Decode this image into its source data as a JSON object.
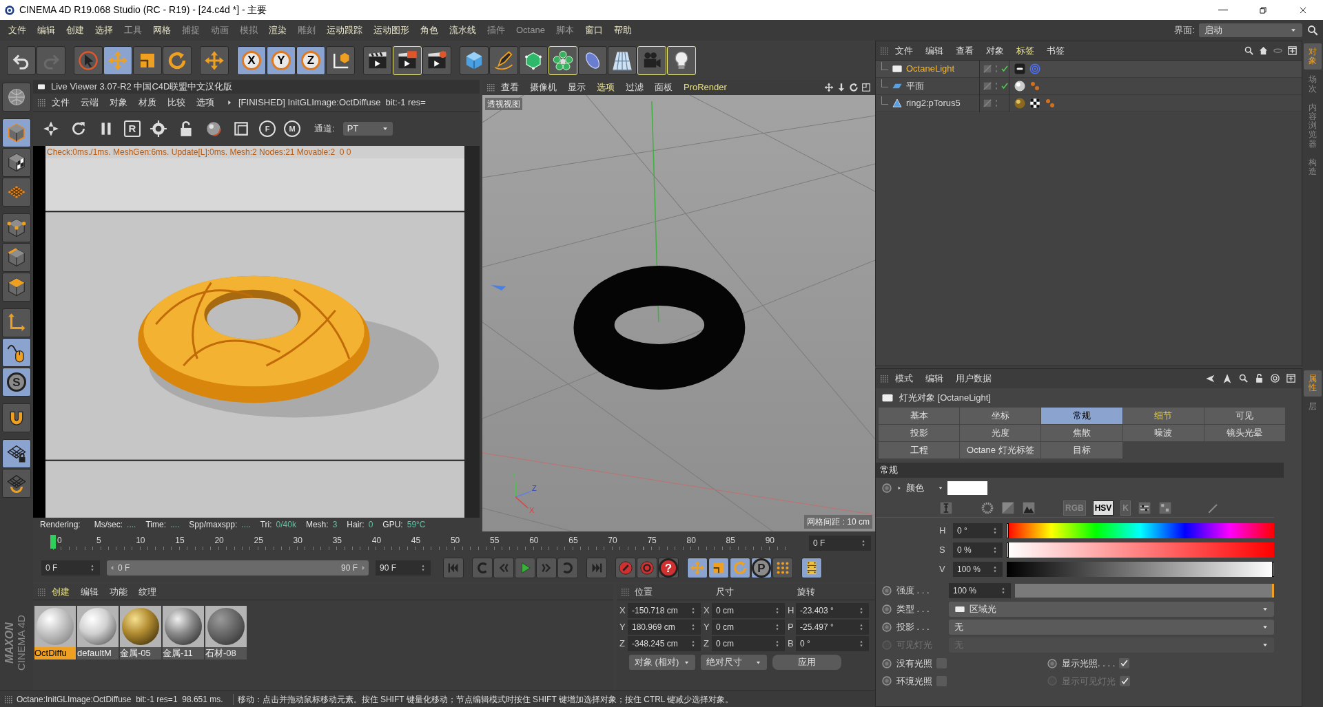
{
  "window": {
    "title": "CINEMA 4D R19.068 Studio (RC - R19) - [24.c4d *] - 主要"
  },
  "menu": [
    {
      "label": "文件",
      "dim": false
    },
    {
      "label": "编辑",
      "dim": false
    },
    {
      "label": "创建",
      "dim": false
    },
    {
      "label": "选择",
      "dim": false
    },
    {
      "label": "工具",
      "dim": true
    },
    {
      "label": "网格",
      "dim": false
    },
    {
      "label": "捕捉",
      "dim": true
    },
    {
      "label": "动画",
      "dim": true
    },
    {
      "label": "模拟",
      "dim": true
    },
    {
      "label": "渲染",
      "dim": false
    },
    {
      "label": "雕刻",
      "dim": true
    },
    {
      "label": "运动跟踪",
      "dim": false
    },
    {
      "label": "运动图形",
      "dim": false
    },
    {
      "label": "角色",
      "dim": false
    },
    {
      "label": "流水线",
      "dim": false
    },
    {
      "label": "插件",
      "dim": true
    },
    {
      "label": "Octane",
      "dim": true
    },
    {
      "label": "脚本",
      "dim": true
    },
    {
      "label": "窗口",
      "dim": false
    },
    {
      "label": "帮助",
      "dim": false
    }
  ],
  "layout": {
    "label": "界面:",
    "value": "启动"
  },
  "toolbar": [
    [
      {
        "kind": "undo",
        "selected": false,
        "highlighted": false
      },
      {
        "kind": "redo",
        "selected": false,
        "highlighted": false
      }
    ],
    [
      {
        "kind": "pointer",
        "selected": false,
        "highlighted": false
      },
      {
        "kind": "move",
        "selected": true,
        "highlighted": false
      },
      {
        "kind": "scale",
        "selected": false,
        "highlighted": false
      },
      {
        "kind": "rotate",
        "selected": false,
        "highlighted": false
      }
    ],
    [
      {
        "kind": "plus",
        "selected": false,
        "highlighted": false
      }
    ],
    [
      {
        "kind": "letter",
        "label": "X",
        "selected": true,
        "highlighted": false
      },
      {
        "kind": "letter",
        "label": "Y",
        "selected": true,
        "highlighted": false
      },
      {
        "kind": "letter",
        "label": "Z",
        "selected": true,
        "highlighted": false
      },
      {
        "kind": "coord",
        "selected": false,
        "highlighted": false
      }
    ],
    [
      {
        "kind": "clap",
        "selected": false,
        "highlighted": false
      },
      {
        "kind": "clap2",
        "selected": false,
        "highlighted": true
      },
      {
        "kind": "clap3",
        "selected": false,
        "highlighted": false
      }
    ],
    [
      {
        "kind": "cube",
        "selected": false,
        "highlighted": false
      },
      {
        "kind": "pen",
        "selected": false,
        "highlighted": false
      },
      {
        "kind": "greencube",
        "selected": false,
        "highlighted": false
      },
      {
        "kind": "flower",
        "selected": false,
        "highlighted": true
      },
      {
        "kind": "deformer",
        "selected": false,
        "highlighted": false
      },
      {
        "kind": "floor",
        "selected": false,
        "highlighted": false
      },
      {
        "kind": "camera",
        "selected": false,
        "highlighted": true
      },
      {
        "kind": "bulb",
        "selected": false,
        "highlighted": true
      }
    ]
  ],
  "left_tools": [
    [
      {
        "kind": "globe",
        "selected": false
      }
    ],
    [
      {
        "kind": "model",
        "selected": true
      },
      {
        "kind": "texture",
        "selected": false
      },
      {
        "kind": "workplane",
        "selected": false
      }
    ],
    [
      {
        "kind": "points",
        "selected": false
      },
      {
        "kind": "edges",
        "selected": false
      },
      {
        "kind": "polys",
        "selected": false
      }
    ],
    [
      {
        "kind": "axis",
        "selected": false
      },
      {
        "kind": "tweak",
        "selected": true
      },
      {
        "kind": "letter",
        "label": "S",
        "selected": true
      }
    ],
    [
      {
        "kind": "magnet",
        "selected": false
      }
    ],
    [
      {
        "kind": "gridlock",
        "selected": true
      },
      {
        "kind": "gridrot",
        "selected": false
      }
    ]
  ],
  "logo": {
    "brand": "MAXON",
    "product": "CINEMA 4D"
  },
  "live_viewer": {
    "title": "Live Viewer 3.07-R2 中国C4D联盟中文汉化版",
    "menu": [
      "文件",
      "云端",
      "对象",
      "材质",
      "比较",
      "选项"
    ],
    "message": "[FINISHED] InitGLImage:OctDiffuse  bit:-1 res=",
    "toolbar": [
      {
        "kind": "aperture"
      },
      {
        "kind": "refresh"
      },
      {
        "kind": "pause"
      },
      {
        "kind": "letter",
        "label": "R"
      },
      {
        "kind": "gear"
      },
      {
        "kind": "lock"
      },
      {
        "kind": "sphere"
      },
      {
        "kind": "frame"
      },
      {
        "kind": "pin",
        "label": "F"
      },
      {
        "kind": "pin",
        "label": "M"
      }
    ],
    "channel_label": "通道:",
    "channel": "PT",
    "log": "Check:0ms./1ms. MeshGen:6ms. Update[L]:0ms. Mesh:2 Nodes:21 Movable:2  0 0",
    "stats": [
      {
        "label": "Rendering:"
      },
      {
        "label": "Ms/sec:",
        "value": "...."
      },
      {
        "label": "Time:",
        "value": "...."
      },
      {
        "label": "Spp/maxspp:",
        "value": "...."
      },
      {
        "label": "Tri:",
        "value": "0/40k"
      },
      {
        "label": "Mesh:",
        "value": "3"
      },
      {
        "label": "Hair:",
        "value": "0"
      },
      {
        "label": "GPU:",
        "value": "59°C"
      }
    ]
  },
  "viewport": {
    "menu": [
      {
        "label": "查看",
        "active": false
      },
      {
        "label": "摄像机",
        "active": false
      },
      {
        "label": "显示",
        "active": false
      },
      {
        "label": "选项",
        "active": true
      },
      {
        "label": "过滤",
        "active": false
      },
      {
        "label": "面板",
        "active": false
      },
      {
        "label": "ProRender",
        "active": true
      }
    ],
    "view_name": "透视视图",
    "axis_labels": [
      {
        "label": "Y",
        "color": "#50c050"
      },
      {
        "label": "Z",
        "color": "#2a48c8"
      },
      {
        "label": "X",
        "color": "#e04040"
      }
    ],
    "grid_spacing": "网格间距 : 10 cm"
  },
  "timeline": {
    "ticks": [
      "0",
      "5",
      "10",
      "15",
      "20",
      "25",
      "30",
      "35",
      "40",
      "45",
      "50",
      "55",
      "60",
      "65",
      "70",
      "75",
      "80",
      "85",
      "90"
    ],
    "level": 0,
    "frame": "0 F"
  },
  "transport": {
    "start": "0 F",
    "range_start": "0 F",
    "range_end": "90 F",
    "level": 1,
    "end": "90 F",
    "groups": [
      [
        {
          "kind": "skipstart",
          "selected": false
        }
      ],
      [
        {
          "kind": "loopback",
          "selected": false
        },
        {
          "kind": "stepback",
          "selected": false
        },
        {
          "kind": "play",
          "selected": false
        },
        {
          "kind": "stepfwd",
          "selected": false
        },
        {
          "kind": "loop",
          "selected": false
        }
      ],
      [
        {
          "kind": "skipend",
          "selected": false
        }
      ],
      [
        {
          "kind": "record",
          "selected": false
        },
        {
          "kind": "autokey",
          "selected": false
        },
        {
          "kind": "help",
          "label": "?",
          "selected": false
        }
      ],
      [
        {
          "kind": "move",
          "selected": true
        },
        {
          "kind": "scale",
          "selected": true
        },
        {
          "kind": "rotate",
          "selected": true
        },
        {
          "kind": "letter",
          "label": "P",
          "selected": true
        },
        {
          "kind": "dots",
          "selected": false
        }
      ],
      [
        {
          "kind": "film",
          "selected": true
        }
      ]
    ]
  },
  "materials": {
    "menu": [
      {
        "label": "创建",
        "active": true
      },
      {
        "label": "编辑",
        "active": false
      },
      {
        "label": "功能",
        "active": false
      },
      {
        "label": "纹理",
        "active": false
      }
    ],
    "items": [
      {
        "name": "OctDiffu",
        "kind": "matte",
        "selected": true
      },
      {
        "name": "defaultM",
        "kind": "glossy",
        "selected": false
      },
      {
        "name": "金属-05",
        "kind": "gold",
        "selected": false
      },
      {
        "name": "金属-11",
        "kind": "chrome",
        "selected": false
      },
      {
        "name": "石材-08",
        "kind": "stone",
        "selected": false
      }
    ]
  },
  "coordinates": {
    "headers": [
      "位置",
      "尺寸",
      "旋转"
    ],
    "rows": [
      [
        {
          "axis": "X",
          "value": "-150.718 cm"
        },
        {
          "axis": "X",
          "value": "0 cm"
        },
        {
          "axis": "H",
          "value": "-23.403 °"
        }
      ],
      [
        {
          "axis": "Y",
          "value": "180.969 cm"
        },
        {
          "axis": "Y",
          "value": "0 cm"
        },
        {
          "axis": "P",
          "value": "-25.497 °"
        }
      ],
      [
        {
          "axis": "Z",
          "value": "-348.245 cm"
        },
        {
          "axis": "Z",
          "value": "0 cm"
        },
        {
          "axis": "B",
          "value": "0 °"
        }
      ]
    ],
    "mode": "对象 (相对)",
    "size_mode": "绝对尺寸",
    "apply": "应用"
  },
  "status_bar": {
    "left": "Octane:InitGLImage:OctDiffuse  bit:-1 res=1  98.651 ms.",
    "right": "移动：点击并拖动鼠标移动元素。按住 SHIFT 键量化移动；节点编辑模式时按住 SHIFT 键增加选择对象；按住 CTRL 键减少选择对象。"
  },
  "object_manager": {
    "menu": [
      {
        "label": "文件",
        "active": false
      },
      {
        "label": "编辑",
        "active": false
      },
      {
        "label": "查看",
        "active": false
      },
      {
        "label": "对象",
        "active": false
      },
      {
        "label": "标签",
        "active": true
      },
      {
        "label": "书签",
        "active": false
      }
    ],
    "objects": [
      {
        "name": "OctaneLight",
        "kind": "light",
        "selected": true,
        "enabled": true
      },
      {
        "name": "平面",
        "kind": "plane",
        "selected": false,
        "enabled": true
      },
      {
        "name": "ring2:pTorus5",
        "kind": "mesh",
        "selected": false,
        "enabled": false
      }
    ]
  },
  "side_tabs_top": [
    {
      "label": "对象",
      "selected": true
    },
    {
      "label": "场次",
      "selected": false
    },
    {
      "label": "内容浏览器",
      "selected": false
    },
    {
      "label": "构造",
      "selected": false
    }
  ],
  "side_tabs_bottom": [
    {
      "label": "属性",
      "selected": true
    },
    {
      "label": "层",
      "selected": false
    }
  ],
  "attributes": {
    "menu": [
      "模式",
      "编辑",
      "用户数据"
    ],
    "title": "灯光对象 [OctaneLight]",
    "tabs": [
      {
        "label": "基本",
        "selected": false,
        "accent": false
      },
      {
        "label": "坐标",
        "selected": false,
        "accent": false
      },
      {
        "label": "常规",
        "selected": true,
        "accent": false
      },
      {
        "label": "细节",
        "selected": false,
        "accent": true
      },
      {
        "label": "可见",
        "selected": false,
        "accent": false
      },
      {
        "label": "投影",
        "selected": false,
        "accent": false
      },
      {
        "label": "光度",
        "selected": false,
        "accent": false
      },
      {
        "label": "焦散",
        "selected": false,
        "accent": false
      },
      {
        "label": "噪波",
        "selected": false,
        "accent": false
      },
      {
        "label": "镜头光晕",
        "selected": false,
        "accent": false
      },
      {
        "label": "工程",
        "selected": false,
        "accent": false
      },
      {
        "label": "Octane 灯光标签",
        "selected": false,
        "accent": false
      },
      {
        "label": "目标",
        "selected": false,
        "accent": false
      }
    ],
    "section": "常规",
    "color_label": "颜色",
    "color_modes": [
      {
        "label": "RGB",
        "selected": false
      },
      {
        "label": "HSV",
        "selected": true
      },
      {
        "label": "K",
        "selected": false
      }
    ],
    "hsv": [
      {
        "label": "H",
        "value": "0 °",
        "level": 0
      },
      {
        "label": "S",
        "value": "0 %",
        "level": 0
      },
      {
        "label": "V",
        "value": "100 %",
        "level": 1
      }
    ],
    "strength": {
      "label": "强度 . . .",
      "value": "100 %",
      "level": 1
    },
    "dropdowns": [
      {
        "label": "类型 . . .",
        "value": "区域光",
        "disabled": false
      },
      {
        "label": "投影 . . .",
        "value": "无",
        "disabled": false
      },
      {
        "label": "可见灯光",
        "value": "无",
        "disabled": true
      }
    ],
    "checks": [
      {
        "label": "没有光照",
        "checked": false,
        "disabled": false
      },
      {
        "label": "显示光照. . . .",
        "checked": true,
        "disabled": false
      },
      {
        "label": "环境光照",
        "checked": false,
        "disabled": false
      },
      {
        "label": "显示可见灯光",
        "checked": true,
        "disabled": true
      }
    ]
  }
}
